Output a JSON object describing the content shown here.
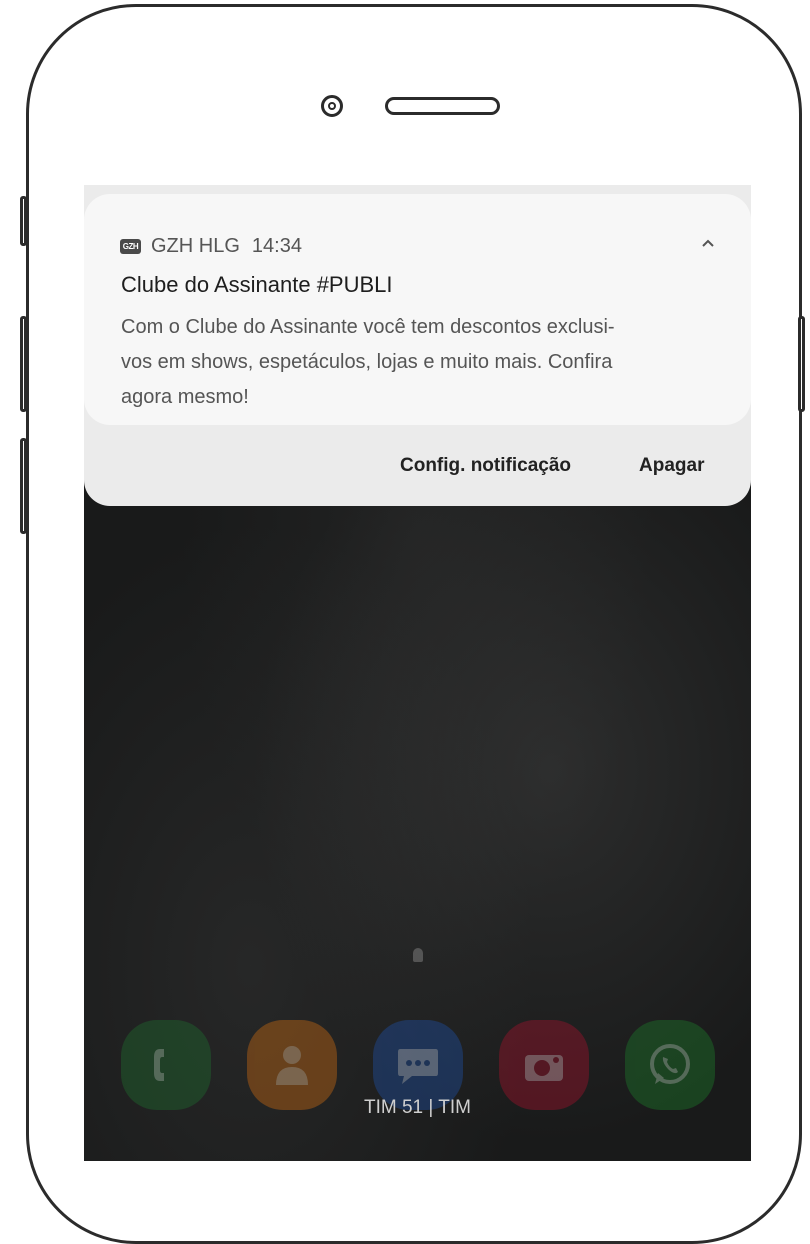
{
  "notification": {
    "app_icon_text": "GZH",
    "app_name": "GZH HLG",
    "time": "14:34",
    "title": "Clube do Assinante #PUBLI",
    "body": "Com o Clube do Assinante você tem descontos exclusi-vos em shows, espetáculos, lojas e muito mais. Confira agora mesmo!",
    "body_lines": [
      "Com o Clube do Assinante você tem descontos exclusi-",
      "vos em shows, espetáculos, lojas e muito mais. Confira",
      "agora mesmo!"
    ],
    "actions": {
      "settings_label": "Config. notificação",
      "clear_label": "Apagar"
    }
  },
  "dock": {
    "apps": [
      {
        "name": "phone",
        "icon": "phone-icon",
        "color": "#1f6b2e"
      },
      {
        "name": "contacts",
        "icon": "contacts-icon",
        "color": "#c86a12"
      },
      {
        "name": "messages",
        "icon": "messages-icon",
        "color": "#1e4fa1"
      },
      {
        "name": "camera",
        "icon": "camera-icon",
        "color": "#a0122c"
      },
      {
        "name": "whatsapp",
        "icon": "whatsapp-icon",
        "color": "#1d7a2a"
      }
    ]
  },
  "status": {
    "carrier": "TIM 51 | TIM"
  }
}
